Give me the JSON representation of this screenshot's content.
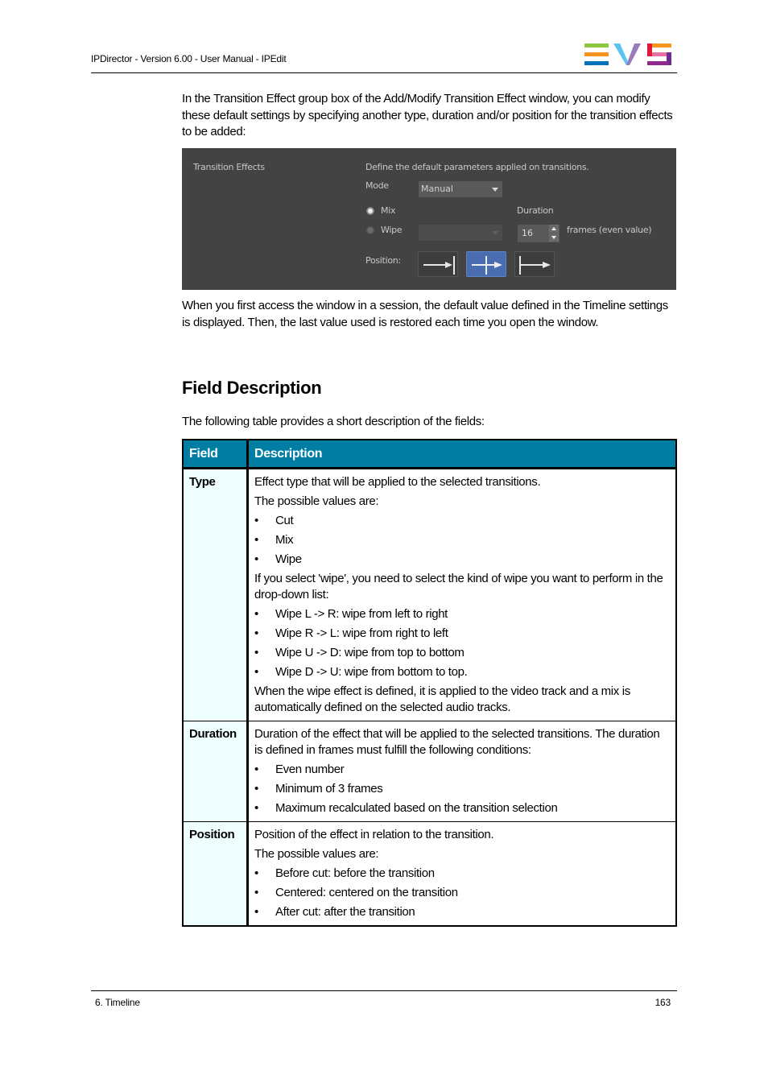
{
  "page_header": {
    "title": "IPDirector - Version 6.00 - User Manual - IPEdit",
    "logo": "EVS",
    "logo_colors": {
      "e_top": "#8dc63f",
      "e_mid": "#f7941d",
      "e_bottom": "#0072bc",
      "v_left": "#5bc5f2",
      "v_right": "#9b7bb8",
      "s_top": "#f7941d",
      "s_top_left": "#e2173a",
      "s_mid": "#e770a4",
      "s_bottom": "#92278f"
    }
  },
  "intro_paragraph": "In the Transition Effect group box of the Add/Modify Transition Effect window, you can modify these default settings by specifying another type, duration and/or position for the transition effects to be added:",
  "screenshot": {
    "group_title": "Transition Effects",
    "description": "Define the default parameters applied on transitions.",
    "mode_label": "Mode",
    "mode_value": "Manual",
    "mix_label": "Mix",
    "mix_selected": true,
    "wipe_label": "Wipe",
    "wipe_selected": false,
    "wipe_dropdown_value": "",
    "duration_label": "Duration",
    "duration_value": "16",
    "duration_unit": "frames (even value)",
    "position_label": "Position:",
    "position_options": [
      "before-cut",
      "centered",
      "after-cut"
    ],
    "position_selected": "centered",
    "accent_color": "#4a6db2"
  },
  "after_paragraph": "When you first access the window in a session, the default value defined in the Timeline settings is displayed. Then, the last value used is restored each time you open the window.",
  "section_title": "Field Description",
  "table_intro": "The following table provides a short description of the fields:",
  "table": {
    "header_color": "#007da3",
    "columns": [
      "Field",
      "Description"
    ],
    "rows": [
      {
        "field": "Type",
        "blocks": [
          {
            "type": "text",
            "text": "Effect type that will be applied to the selected transitions."
          },
          {
            "type": "text",
            "text": "The possible values are:"
          },
          {
            "type": "bullet",
            "text": "Cut"
          },
          {
            "type": "bullet",
            "text": "Mix"
          },
          {
            "type": "bullet",
            "text": "Wipe"
          },
          {
            "type": "text",
            "text": "If you select 'wipe', you need to select the kind of wipe you want to perform in the drop-down list:"
          },
          {
            "type": "bullet",
            "text": "Wipe L -> R: wipe from left to right"
          },
          {
            "type": "bullet",
            "text": "Wipe R -> L: wipe from right to left"
          },
          {
            "type": "bullet",
            "text": "Wipe U -> D: wipe from top to bottom"
          },
          {
            "type": "bullet",
            "text": "Wipe D -> U: wipe from bottom to top."
          },
          {
            "type": "text",
            "text": "When the wipe effect is defined, it is applied to the video track and a mix is automatically defined on the selected audio tracks."
          }
        ]
      },
      {
        "field": "Duration",
        "blocks": [
          {
            "type": "text",
            "text": "Duration of the effect that will be applied to the selected transitions. The duration is defined in frames must fulfill the following conditions:"
          },
          {
            "type": "bullet",
            "text": "Even number"
          },
          {
            "type": "bullet",
            "text": "Minimum of 3 frames"
          },
          {
            "type": "bullet",
            "text": "Maximum recalculated based on the transition selection"
          }
        ]
      },
      {
        "field": "Position",
        "blocks": [
          {
            "type": "text",
            "text": "Position of the effect in relation to the transition."
          },
          {
            "type": "text",
            "text": "The possible values are:"
          },
          {
            "type": "bullet",
            "text": "Before cut: before the transition"
          },
          {
            "type": "bullet",
            "text": "Centered: centered on the transition"
          },
          {
            "type": "bullet",
            "text": "After cut: after the transition"
          }
        ]
      }
    ]
  },
  "footer": {
    "chapter": "6. Timeline",
    "page_number": "163"
  }
}
